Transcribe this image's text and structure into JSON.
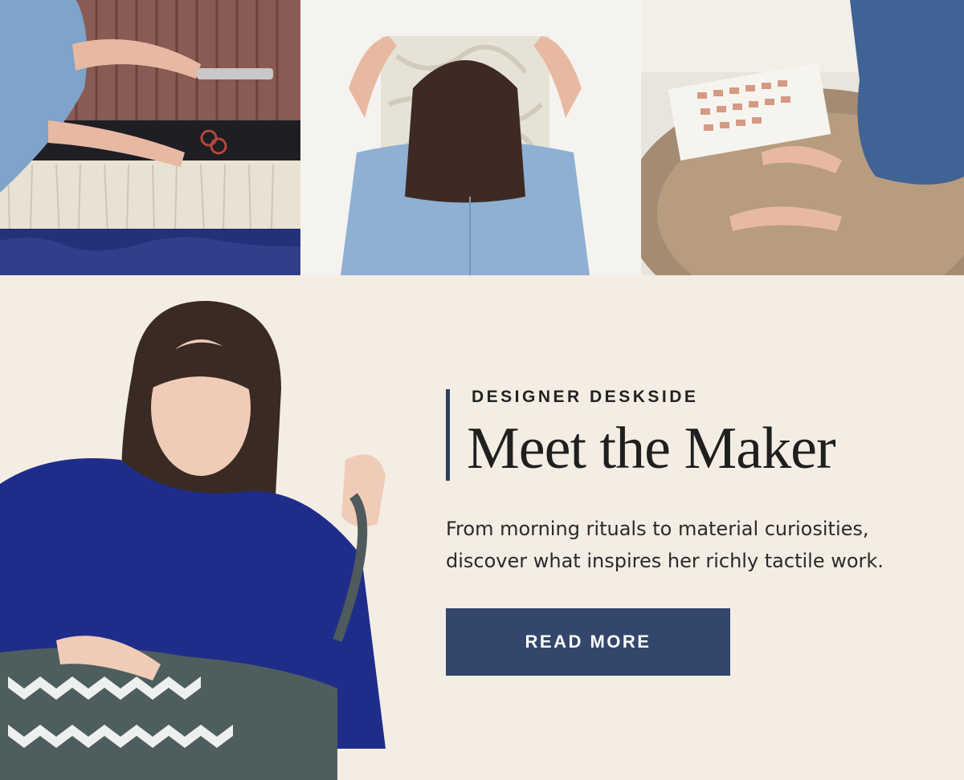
{
  "photos": [
    {
      "name": "weaving-trim-photo",
      "alt": "Hands trimming woven fringe with scissors and comb"
    },
    {
      "name": "hanging-textile-photo",
      "alt": "Maker holding a woven piece against a wall"
    },
    {
      "name": "color-swatches-photo",
      "alt": "Arranging color swatches on a tufted rug"
    }
  ],
  "hero": {
    "image_name": "maker-portrait-photo",
    "eyebrow": "DESIGNER DESKSIDE",
    "headline": "Meet the Maker",
    "body": "From morning rituals to material curiosities, discover what inspires her richly tactile work.",
    "cta_label": "READ MORE"
  },
  "colors": {
    "background": "#f4ede4",
    "accent": "#34466b",
    "text": "#1f1f1f"
  }
}
